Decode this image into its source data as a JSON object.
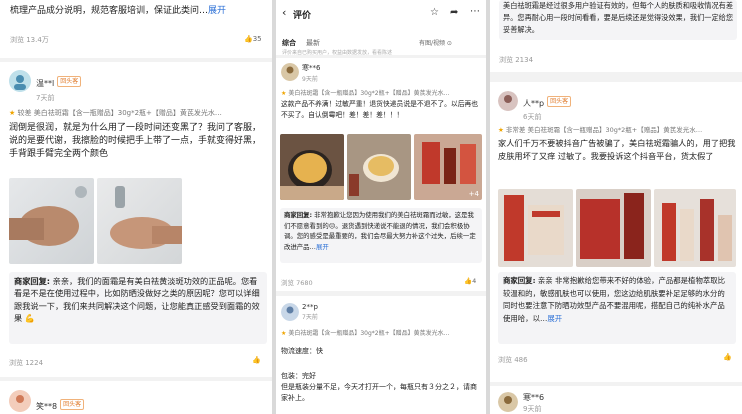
{
  "col1": {
    "top": {
      "text": "梳理产品成分说明，规范客服培训，保证此类问…",
      "expand": "展开",
      "views": "浏览 13.4万",
      "likes": "35"
    },
    "review": {
      "user": "温**l",
      "badge": "回头客",
      "time": "7天前",
      "spec_prefix": "较差",
      "spec": "美白祛斑霜【含一瓶赠品】30g*2瓶+【赠品】黄芪发光水…",
      "body": "润倒是很润，就是为什么用了一段时间还变黑了？我问了客服，说的是要代谢，我擦脸的时候把手上带了一点，手就变得好黑，手背跟手臂完全两个颜色",
      "reply_label": "商家回复:",
      "reply": "亲亲，我们的面霜是有美白祛黄淡斑功效的正品呢。您看看是不是在使用过程中，比如防晒没做好之类的原因呢？您可以详细跟我说一下，我们来共同解决这个问题，让您能真正感受到面霜的效果",
      "views": "浏览 1224"
    },
    "next": {
      "user": "笑**8",
      "badge": "回头客"
    }
  },
  "col2": {
    "header": {
      "title": "评价",
      "tab_all": "综合",
      "tab_new": "最新",
      "filter": "有图/视频 ⊙",
      "notice": "评价来自已购买用户，权益由数据发放，看看陈述"
    },
    "review1": {
      "user": "寒**6",
      "time": "9天前",
      "spec": "美白祛斑霜【含一瓶赠品】30g*2瓶+【赠品】黄芪发光水…",
      "body": "这款产品不养满！过敏严重！退货快递员说是不退不了。以后再也不买了。自认倒霉吧！差！差！差！！！",
      "more": "+4",
      "reply_label": "商家回复:",
      "reply": "非常抱歉让您因为使用我们的美白祛斑霜而过敏，这是我们不愿意看到的😔。退货遇到快递说不能退的情况，我们会积极协调。您的感受是最重要的，我们会尽最大努力补这个过失，后续一定改进产品…",
      "expand": "展开",
      "views": "浏览 7680",
      "likes": "4"
    },
    "review2": {
      "user": "2**p",
      "time": "7天前",
      "spec": "美白祛斑霜【含一瓶赠品】30g*2瓶+【赠品】黄芪发光水…",
      "logistics": "物流速度：快",
      "packaging": "包装：完好",
      "body": "但是瓶装分量不足，今天才打开一个，每瓶只有３分之２，请商家补上。"
    }
  },
  "col3": {
    "top": {
      "text": "美白祛斑霜是经过很多用户验证有效的，但每个人的肤质和吸收情况有差异。您再耐心用一段时间看看，要是后续还是觉得没效果，我们一定给您妥善解决。",
      "views": "浏览 2134"
    },
    "review": {
      "user": "人**p",
      "badge": "回头客",
      "time": "6天前",
      "spec_prefix": "非常差",
      "spec": "美白祛斑霜【含一瓶赠品】30g*2瓶+【赠品】黄芪发光水…",
      "body": "家人们千万不要被抖音广告被骗了，美白祛斑霜骗人的，用了把我皮肤用坏了又痒 过敏了。我要投诉这个抖音平台，货太假了",
      "reply_label": "商家回复:",
      "reply": "亲亲 非常抱歉给您带来不好的体验，产品都是植物萃取比较温和的，敏感肌肤也可以使用，您这边给肌肤要补足足够的水分的同时也要注意下防晒功效型产品不要混用呢，搭配自己的纯补水产品使用哈，以…",
      "expand": "展开",
      "views": "浏览 486"
    },
    "next": {
      "user": "寒**6",
      "time": "9天前"
    }
  }
}
